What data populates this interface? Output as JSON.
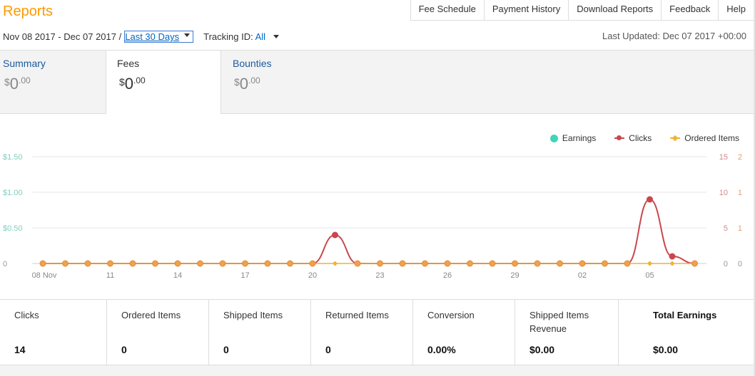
{
  "header": {
    "title": "Reports",
    "nav": [
      "Fee Schedule",
      "Payment History",
      "Download Reports",
      "Feedback",
      "Help"
    ]
  },
  "filters": {
    "date_range": "Nov 08 2017 - Dec 07 2017 /",
    "range_option": "Last 30 Days",
    "tracking_label": "Tracking ID:",
    "tracking_value": "All",
    "last_updated": "Last Updated: Dec 07 2017 +00:00"
  },
  "tabs": [
    {
      "label": "Summary",
      "currency": "$",
      "whole": "0",
      "cents": ".00",
      "active": false
    },
    {
      "label": "Fees",
      "currency": "$",
      "whole": "0",
      "cents": ".00",
      "active": true
    },
    {
      "label": "Bounties",
      "currency": "$",
      "whole": "0",
      "cents": ".00",
      "active": false
    }
  ],
  "legend": [
    {
      "name": "Earnings",
      "color": "#3fd6b8",
      "icon": "circle"
    },
    {
      "name": "Clicks",
      "color": "#c9474b",
      "icon": "line-dot"
    },
    {
      "name": "Ordered Items",
      "color": "#f0b232",
      "icon": "line-diamond"
    }
  ],
  "chart_data": {
    "type": "line",
    "x": [
      "Nov 08",
      "Nov 09",
      "Nov 10",
      "Nov 11",
      "Nov 12",
      "Nov 13",
      "Nov 14",
      "Nov 15",
      "Nov 16",
      "Nov 17",
      "Nov 18",
      "Nov 19",
      "Nov 20",
      "Nov 21",
      "Nov 22",
      "Nov 23",
      "Nov 24",
      "Nov 25",
      "Nov 26",
      "Nov 27",
      "Nov 28",
      "Nov 29",
      "Nov 30",
      "Dec 01",
      "Dec 02",
      "Dec 03",
      "Dec 04",
      "Dec 05",
      "Dec 06",
      "Dec 07"
    ],
    "x_tick_labels": [
      "08 Nov",
      "11",
      "14",
      "17",
      "20",
      "23",
      "26",
      "29",
      "02",
      "05"
    ],
    "y_left_ticks": [
      "$1.50",
      "$1.00",
      "$0.50",
      "0"
    ],
    "y_right1_ticks": [
      "15",
      "10",
      "5",
      "0"
    ],
    "y_right2_ticks": [
      "2",
      "1",
      "1",
      "0"
    ],
    "ylim_left": [
      0,
      1.5
    ],
    "ylim_clicks": [
      0,
      15
    ],
    "ylim_ordered": [
      0,
      2
    ],
    "grid": true,
    "legend_position": "top-right",
    "series": [
      {
        "name": "Earnings",
        "color": "#3fd6b8",
        "values": [
          0,
          0,
          0,
          0,
          0,
          0,
          0,
          0,
          0,
          0,
          0,
          0,
          0,
          0,
          0,
          0,
          0,
          0,
          0,
          0,
          0,
          0,
          0,
          0,
          0,
          0,
          0,
          0,
          0,
          0
        ]
      },
      {
        "name": "Clicks",
        "color": "#c9474b",
        "values": [
          0,
          0,
          0,
          0,
          0,
          0,
          0,
          0,
          0,
          0,
          0,
          0,
          0,
          4,
          0,
          0,
          0,
          0,
          0,
          0,
          0,
          0,
          0,
          0,
          0,
          0,
          0,
          9,
          1,
          0
        ]
      },
      {
        "name": "Ordered Items",
        "color": "#f0b232",
        "values": [
          0,
          0,
          0,
          0,
          0,
          0,
          0,
          0,
          0,
          0,
          0,
          0,
          0,
          0,
          0,
          0,
          0,
          0,
          0,
          0,
          0,
          0,
          0,
          0,
          0,
          0,
          0,
          0,
          0,
          0
        ]
      }
    ]
  },
  "stats": [
    {
      "label": "Clicks",
      "value": "14"
    },
    {
      "label": "Ordered Items",
      "value": "0"
    },
    {
      "label": "Shipped Items",
      "value": "0"
    },
    {
      "label": "Returned Items",
      "value": "0"
    },
    {
      "label": "Conversion",
      "value": "0.00%"
    },
    {
      "label": "Shipped Items Revenue",
      "value": "$0.00"
    },
    {
      "label": "Total Earnings",
      "value": "$0.00"
    }
  ]
}
